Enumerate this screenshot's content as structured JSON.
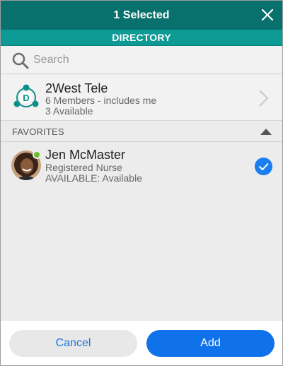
{
  "header": {
    "title": "1 Selected"
  },
  "subheader": {
    "title": "DIRECTORY"
  },
  "search": {
    "placeholder": "Search",
    "value": ""
  },
  "group": {
    "icon_letter": "D",
    "name": "2West Tele",
    "members": "6 Members - includes me",
    "available": "3 Available"
  },
  "favorites": {
    "title": "FAVORITES",
    "contacts": [
      {
        "name": "Jen McMaster",
        "role": "Registered Nurse",
        "status": "AVAILABLE: Available",
        "presence": "available",
        "selected": true
      }
    ]
  },
  "footer": {
    "cancel_label": "Cancel",
    "add_label": "Add"
  },
  "colors": {
    "header_bg": "#08706d",
    "subheader_bg": "#0d9a94",
    "accent_blue": "#0f72ea",
    "presence_green": "#6cbf28"
  }
}
